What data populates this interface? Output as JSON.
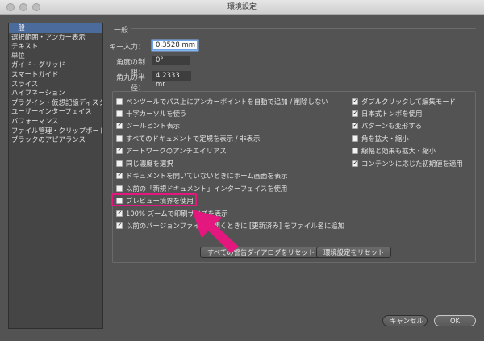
{
  "window": {
    "title": "環境設定"
  },
  "sidebar": {
    "items": [
      {
        "label": "一般",
        "selected": true
      },
      {
        "label": "選択範囲・アンカー表示"
      },
      {
        "label": "テキスト"
      },
      {
        "label": "単位"
      },
      {
        "label": "ガイド・グリッド"
      },
      {
        "label": "スマートガイド"
      },
      {
        "label": "スライス"
      },
      {
        "label": "ハイフネーション"
      },
      {
        "label": "プラグイン・仮想記憶ディスク"
      },
      {
        "label": "ユーザーインターフェイス"
      },
      {
        "label": "パフォーマンス"
      },
      {
        "label": "ファイル管理・クリップボード"
      },
      {
        "label": "ブラックのアピアランス"
      }
    ]
  },
  "general": {
    "section_title": "一般",
    "key_input_label": "キー入力：",
    "key_input_value": "0.3528 mm",
    "angle_label": "角度の制限：",
    "angle_value": "0°",
    "corner_label": "角丸の半径：",
    "corner_value": "4.2333 mr"
  },
  "options_left": [
    {
      "label": "ペンツールでパス上にアンカーポイントを自動で追加 / 削除しない",
      "checked": false
    },
    {
      "label": "十字カーソルを使う",
      "checked": false
    },
    {
      "label": "ツールヒント表示",
      "checked": true
    },
    {
      "label": "すべてのドキュメントで定規を表示 / 非表示",
      "checked": false
    },
    {
      "label": "アートワークのアンチエイリアス",
      "checked": true
    },
    {
      "label": "同じ濃度を選択",
      "checked": false
    },
    {
      "label": "ドキュメントを開いていないときにホーム画面を表示",
      "checked": true
    },
    {
      "label": "以前の「新規ドキュメント」インターフェイスを使用",
      "checked": false
    },
    {
      "label": "プレビュー境界を使用",
      "checked": false
    },
    {
      "label": "100% ズームで印刷サイズを表示",
      "checked": true
    },
    {
      "label": "以前のバージョンファイルを開くときに [更新済み] をファイル名に追加",
      "checked": true
    }
  ],
  "options_right": [
    {
      "label": "ダブルクリックして編集モード",
      "checked": true
    },
    {
      "label": "日本式トンボを使用",
      "checked": true
    },
    {
      "label": "パターンも変形する",
      "checked": true
    },
    {
      "label": "角を拡大・縮小",
      "checked": false
    },
    {
      "label": "線幅と効果も拡大・縮小",
      "checked": false
    },
    {
      "label": "コンテンツに応じた初期値を適用",
      "checked": true
    }
  ],
  "buttons": {
    "reset_warnings": "すべての警告ダイアログをリセット",
    "reset_prefs": "環境設定をリセット",
    "cancel": "キャンセル",
    "ok": "OK"
  },
  "colors": {
    "highlight": "#e3177e",
    "selected_sidebar": "#4b6b9c",
    "background": "#535353"
  }
}
